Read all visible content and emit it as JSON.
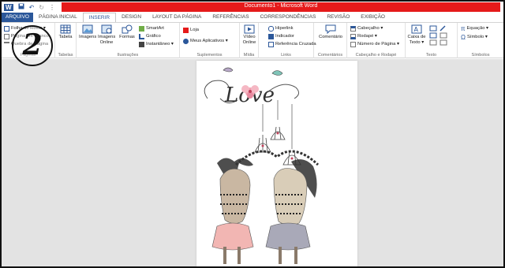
{
  "title": "Documento1 - Microsoft Word",
  "qat": {
    "word_icon": "W",
    "save_icon": "💾",
    "undo_icon": "↶",
    "redo_icon": "↻",
    "more_icon": "⋮"
  },
  "tabs": [
    {
      "label": "ARQUIVO"
    },
    {
      "label": "PÁGINA INICIAL"
    },
    {
      "label": "INSERIR"
    },
    {
      "label": "DESIGN"
    },
    {
      "label": "LAYOUT DA PÁGINA"
    },
    {
      "label": "REFERÊNCIAS"
    },
    {
      "label": "CORRESPONDÊNCIAS"
    },
    {
      "label": "REVISÃO"
    },
    {
      "label": "EXIBIÇÃO"
    }
  ],
  "ribbon": {
    "pages": {
      "label": "Páginas",
      "folha_de_rosto": "Folha de Rosto ▾",
      "pagina_em_branco": "Página em Branco",
      "quebra_de_pagina": "Quebra de Página"
    },
    "tabelas": {
      "label": "Tabelas",
      "tabela": "Tabela"
    },
    "ilustracoes": {
      "label": "Ilustrações",
      "imagens": "Imagens",
      "imagens_online": "Imagens Online",
      "formas": "Formas",
      "smartart": "SmartArt",
      "grafico": "Gráfico",
      "instantaneo": "Instantâneo ▾"
    },
    "suplementos": {
      "label": "Suplementos",
      "loja": "Loja",
      "meus_aplicativos": "Meus Aplicativos ▾"
    },
    "midia": {
      "label": "Mídia",
      "video_online": "Vídeo Online"
    },
    "links": {
      "label": "Links",
      "hiperlink": "Hiperlink",
      "indicador": "Indicador",
      "referencia_cruzada": "Referência Cruzada"
    },
    "comentarios": {
      "label": "Comentários",
      "comentario": "Comentário"
    },
    "cabecalho": {
      "label": "Cabeçalho e Rodapé",
      "cabecalho": "Cabeçalho ▾",
      "rodape": "Rodapé ▾",
      "numero_de_pagina": "Número de Página ▾"
    },
    "texto": {
      "label": "Texto",
      "caixa_de_texto": "Caixa de Texto ▾"
    },
    "simbolos": {
      "label": "Símbolos",
      "equacao": "Equação ▾",
      "simbolo": "Símbolo ▾",
      "pi_icon": "π",
      "omega_icon": "Ω"
    }
  },
  "document": {
    "love_text": "Love"
  },
  "annotation": {
    "number": "2"
  },
  "colors": {
    "word_blue": "#2b579a",
    "title_red": "#e51a1a",
    "ribbon_bg": "#ffffff",
    "doc_bg": "#e3e3e3"
  }
}
